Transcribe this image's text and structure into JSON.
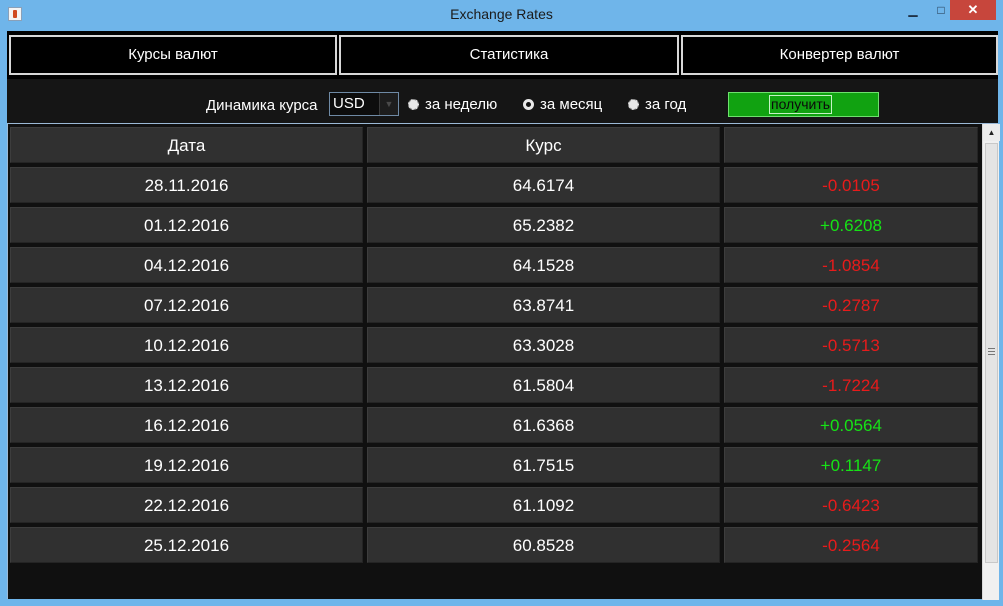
{
  "window": {
    "title": "Exchange Rates",
    "minimize_glyph": "▁",
    "maximize_glyph": "□",
    "close_glyph": "✕",
    "app_icon": "java-cup-icon"
  },
  "tabs": [
    {
      "label": "Курсы валют"
    },
    {
      "label": "Статистика"
    },
    {
      "label": "Конвертер валют"
    }
  ],
  "controls": {
    "dynamics_label": "Динамика курса",
    "currency": {
      "selected": "USD",
      "arrow_glyph": "▼"
    },
    "periods": [
      {
        "label": "за неделю",
        "selected": false
      },
      {
        "label": "за месяц",
        "selected": true
      },
      {
        "label": "за год",
        "selected": false
      }
    ],
    "get_button": "получить"
  },
  "table": {
    "headers": [
      "Дата",
      "Курс",
      ""
    ],
    "rows": [
      {
        "date": "28.11.2016",
        "rate": "64.6174",
        "change": "-0.0105",
        "trend": "down"
      },
      {
        "date": "01.12.2016",
        "rate": "65.2382",
        "change": "+0.6208",
        "trend": "up"
      },
      {
        "date": "04.12.2016",
        "rate": "64.1528",
        "change": "-1.0854",
        "trend": "down"
      },
      {
        "date": "07.12.2016",
        "rate": "63.8741",
        "change": "-0.2787",
        "trend": "down"
      },
      {
        "date": "10.12.2016",
        "rate": "63.3028",
        "change": "-0.5713",
        "trend": "down"
      },
      {
        "date": "13.12.2016",
        "rate": "61.5804",
        "change": "-1.7224",
        "trend": "down"
      },
      {
        "date": "16.12.2016",
        "rate": "61.6368",
        "change": "+0.0564",
        "trend": "up"
      },
      {
        "date": "19.12.2016",
        "rate": "61.7515",
        "change": "+0.1147",
        "trend": "up"
      },
      {
        "date": "22.12.2016",
        "rate": "61.1092",
        "change": "-0.6423",
        "trend": "down"
      },
      {
        "date": "25.12.2016",
        "rate": "60.8528",
        "change": "-0.2564",
        "trend": "down"
      }
    ]
  },
  "scrollbar": {
    "up_glyph": "▲"
  },
  "colors": {
    "accent_blue": "#6fb5ea",
    "positive": "#16e316",
    "negative": "#e81b1b",
    "button_green": "#11a211"
  }
}
